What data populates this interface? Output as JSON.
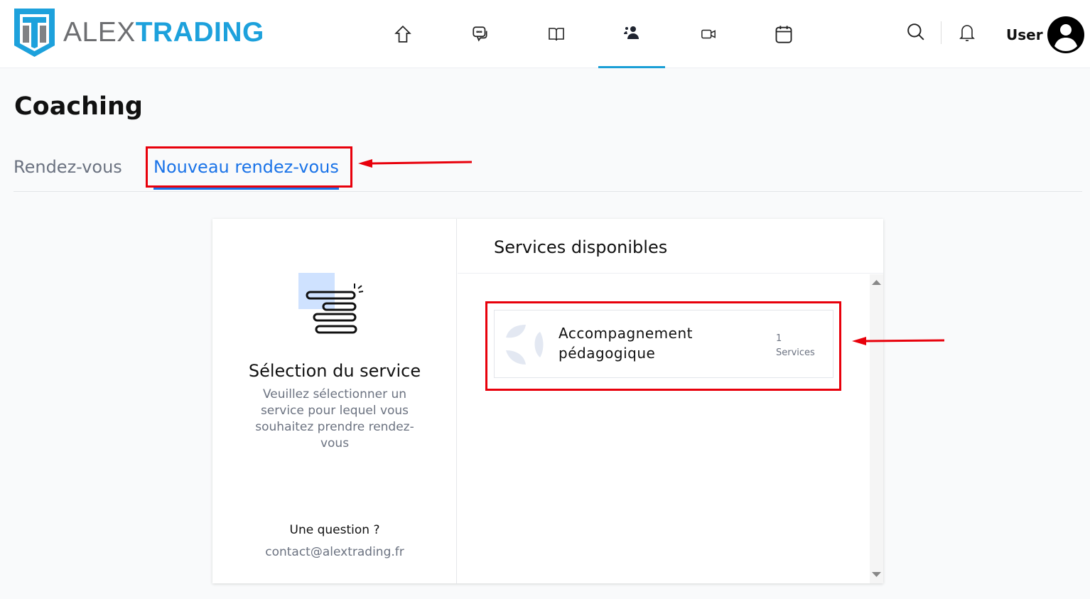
{
  "brand": {
    "name_part1": "ALEX",
    "name_part2": "TRADING",
    "accent": "#1da1dc"
  },
  "nav": [
    {
      "icon": "home-icon"
    },
    {
      "icon": "chat-icon"
    },
    {
      "icon": "book-icon"
    },
    {
      "icon": "users-icon",
      "active": true
    },
    {
      "icon": "video-icon"
    },
    {
      "icon": "calendar-icon"
    }
  ],
  "header": {
    "user_label": "User"
  },
  "page": {
    "title": "Coaching"
  },
  "tabs": [
    {
      "label": "Rendez-vous"
    },
    {
      "label": "Nouveau rendez-vous",
      "active": true
    }
  ],
  "left_panel": {
    "title": "Sélection du service",
    "description": "Veuillez sélectionner un service pour lequel vous souhaitez prendre rendez-vous",
    "question": "Une question ?",
    "email": "contact@alextrading.fr"
  },
  "right_panel": {
    "title": "Services disponibles",
    "services": [
      {
        "name": "Accompagnement pédagogique",
        "count": "1",
        "count_label": "Services"
      }
    ]
  }
}
